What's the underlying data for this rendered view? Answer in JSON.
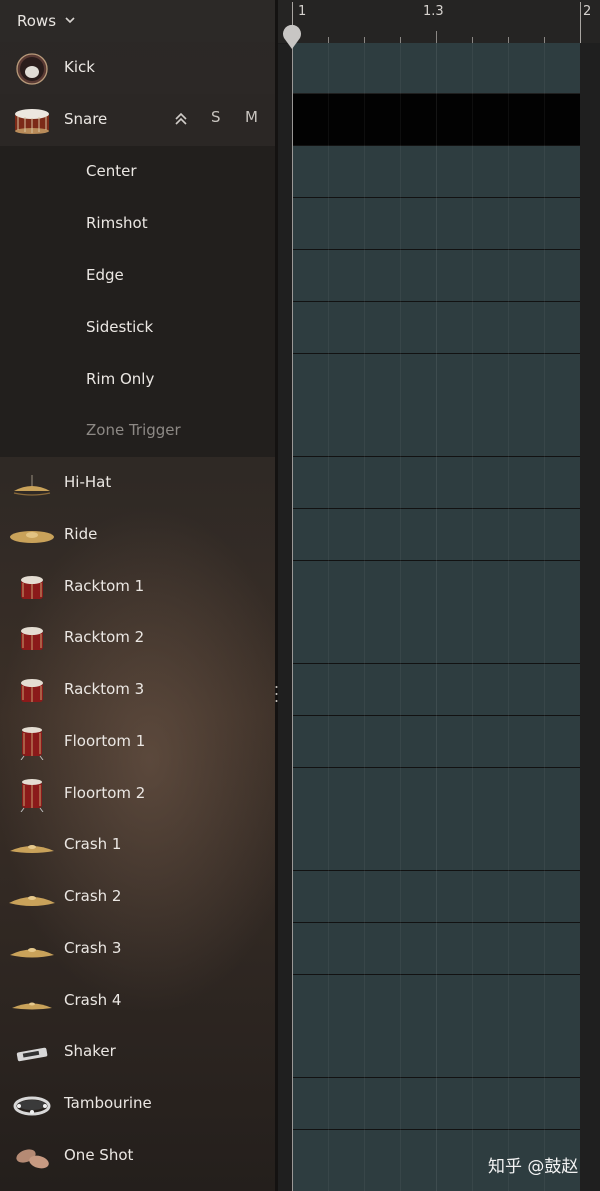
{
  "header": {
    "rows_label": "Rows"
  },
  "snare_buttons": {
    "collapse": "collapse-icon",
    "solo": "S",
    "mute": "M"
  },
  "rows": [
    {
      "label": "Kick",
      "icon": "kick-drum-icon"
    },
    {
      "label": "Snare",
      "icon": "snare-drum-icon"
    },
    {
      "label": "Center"
    },
    {
      "label": "Rimshot"
    },
    {
      "label": "Edge"
    },
    {
      "label": "Sidestick"
    },
    {
      "label": "Rim Only"
    },
    {
      "label": "Zone Trigger"
    },
    {
      "label": "Hi-Hat",
      "icon": "hi-hat-icon"
    },
    {
      "label": "Ride",
      "icon": "ride-cymbal-icon"
    },
    {
      "label": "Racktom 1",
      "icon": "racktom-icon"
    },
    {
      "label": "Racktom 2",
      "icon": "racktom-icon"
    },
    {
      "label": "Racktom 3",
      "icon": "racktom-icon"
    },
    {
      "label": "Floortom 1",
      "icon": "floortom-icon"
    },
    {
      "label": "Floortom 2",
      "icon": "floortom-icon"
    },
    {
      "label": "Crash 1",
      "icon": "crash-cymbal-icon"
    },
    {
      "label": "Crash 2",
      "icon": "crash-cymbal-icon"
    },
    {
      "label": "Crash 3",
      "icon": "crash-cymbal-icon"
    },
    {
      "label": "Crash 4",
      "icon": "crash-cymbal-icon"
    },
    {
      "label": "Shaker",
      "icon": "shaker-icon"
    },
    {
      "label": "Tambourine",
      "icon": "tambourine-icon"
    },
    {
      "label": "One Shot",
      "icon": "one-shot-icon"
    }
  ],
  "ruler": {
    "bar_1": "1",
    "bar_1_3": "1.3",
    "bar_2": "2"
  },
  "colors": {
    "lane": "#2e3d40",
    "selected_lane": "#020202",
    "drum_red": "#8b1a1a",
    "cymbal_gold": "#c9a25a"
  },
  "watermark": "知乎 @鼓赵"
}
